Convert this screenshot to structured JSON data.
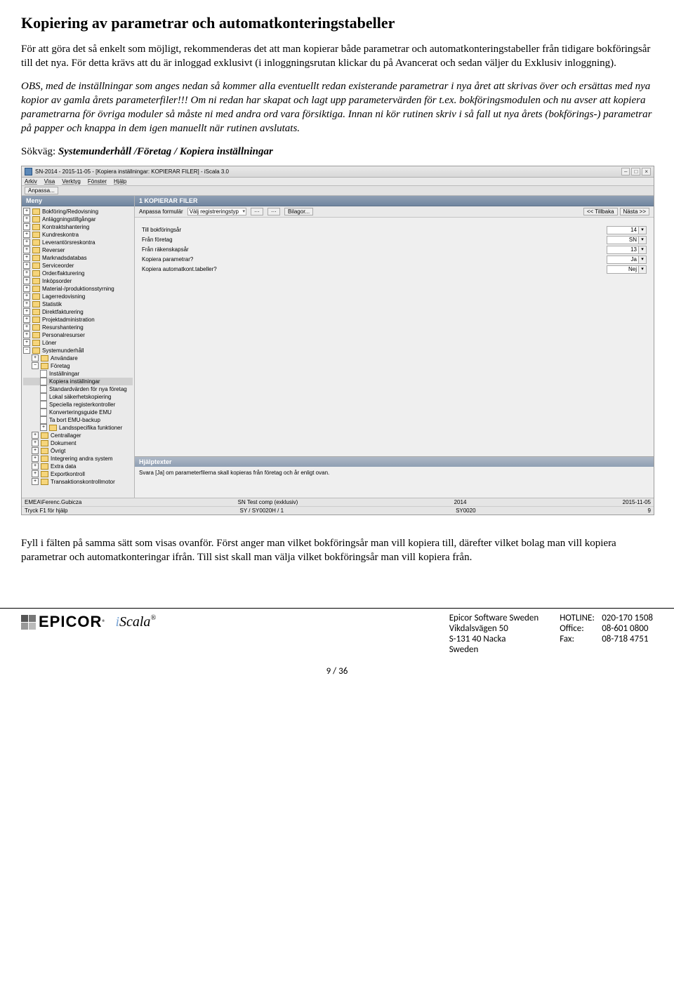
{
  "heading": "Kopiering av parametrar och automatkonteringstabeller",
  "p1": "För att göra det så enkelt som möjligt, rekommenderas det att man kopierar både parametrar och automatkonteringstabeller från tidigare bokföringsår till det nya. För detta krävs att du är inloggad exklusivt (i inloggningsrutan klickar du på Avancerat och sedan väljer du Exklusiv inloggning).",
  "p2": "OBS, med de inställningar som anges nedan så kommer alla eventuellt redan existerande parametrar i nya året att skrivas över och ersättas med nya kopior av gamla årets parameterfiler!!! Om ni redan har skapat och lagt upp parametervärden för t.ex. bokföringsmodulen och nu avser att kopiera parametrarna för övriga moduler så måste ni med andra ord vara försiktiga. Innan ni kör rutinen skriv i så fall ut nya årets (bokförings-) parametrar på papper och knappa in dem igen manuellt när rutinen avslutats.",
  "path_label": "Sökväg: ",
  "path_value": "Systemunderhåll /Företag / Kopiera inställningar",
  "app": {
    "title": "SN-2014 - 2015-11-05 - [Kopiera inställningar: KOPIERAR FILER] - iScala 3.0",
    "menus": [
      "Arkiv",
      "Visa",
      "Verktyg",
      "Fönster",
      "Hjälp"
    ],
    "customize_btn": "Anpassa...",
    "menu_header": "Meny",
    "tree_top": [
      "Bokföring/Redovisning",
      "Anläggningstillgångar",
      "Kontraktshantering",
      "Kundreskontra",
      "Leverantörsreskontra",
      "Reverser",
      "Marknadsdatabas",
      "Serviceorder",
      "Order/fakturering",
      "Inköpsorder",
      "Material-/produktionsstyrning",
      "Lagerredovisning",
      "Statistik",
      "Direktfakturering",
      "Projektadministration",
      "Resurshantering",
      "Personalresurser",
      "Löner"
    ],
    "tree_sys": "Systemunderhåll",
    "tree_sys_sub1": "Användare",
    "tree_sys_foretag": "Företag",
    "tree_foretag_children": [
      "Inställningar",
      "Kopiera inställningar",
      "Standardvärden för nya företag",
      "Lokal säkerhetskopiering",
      "Speciella registerkontroller",
      "Konverteringsguide EMU",
      "Ta bort EMU-backup",
      "Landsspecifika funktioner"
    ],
    "tree_sys_tail": [
      "Centrallager",
      "Dokument",
      "Övrigt",
      "Integrering andra system",
      "Extra data",
      "Exportkontroll",
      "Transaktionskontrollmotor"
    ],
    "form_header": "1 KOPIERAR FILER",
    "form_toolbar": {
      "lbl": "Anpassa formulär",
      "ddl": "Välj registreringstyp",
      "btn_bilagor": "Bilagor...",
      "btn_back": "<< Tillbaka",
      "btn_next": "Nästa >>"
    },
    "fields": [
      {
        "label": "Till bokföringsår",
        "value": "14"
      },
      {
        "label": "Från företag",
        "value": "SN"
      },
      {
        "label": "Från räkenskapsår",
        "value": "13"
      },
      {
        "label": "Kopiera parametrar?",
        "value": "Ja"
      },
      {
        "label": "Kopiera automatkont.tabeller?",
        "value": "Nej"
      }
    ],
    "help_header": "Hjälptexter",
    "help_body": "Svara [Ja] om parameterfilerna skall kopieras från företag och år enligt ovan.",
    "status1": {
      "user": "EMEA\\Ferenc.Gubicza",
      "comp": "SN Test comp (exklusiv)",
      "year": "2014",
      "date": "2015-11-05"
    },
    "status2": {
      "hint": "Tryck F1 för hjälp",
      "loc": "SY / SY0020H / 1",
      "code": "SY0020",
      "n": "9"
    }
  },
  "p3": "Fyll i fälten på samma sätt som visas ovanför. Först anger man vilket bokföringsår man vill kopiera till, därefter vilket bolag man vill kopiera parametrar och automatkonteringar ifrån. Till sist skall man välja vilket bokföringsår man vill kopiera från.",
  "footer": {
    "epicor": "EPICOR",
    "iscala": "iScala",
    "addr": [
      "Epicor Software Sweden",
      "Vikdalsvägen 50",
      "S-131 40 Nacka",
      "Sweden"
    ],
    "contacts": [
      {
        "l": "HOTLINE:",
        "v": "020-170 1508"
      },
      {
        "l": "Office:",
        "v": "08-601 0800"
      },
      {
        "l": "Fax:",
        "v": "08-718 4751"
      }
    ],
    "pagenum": "9 / 36"
  }
}
